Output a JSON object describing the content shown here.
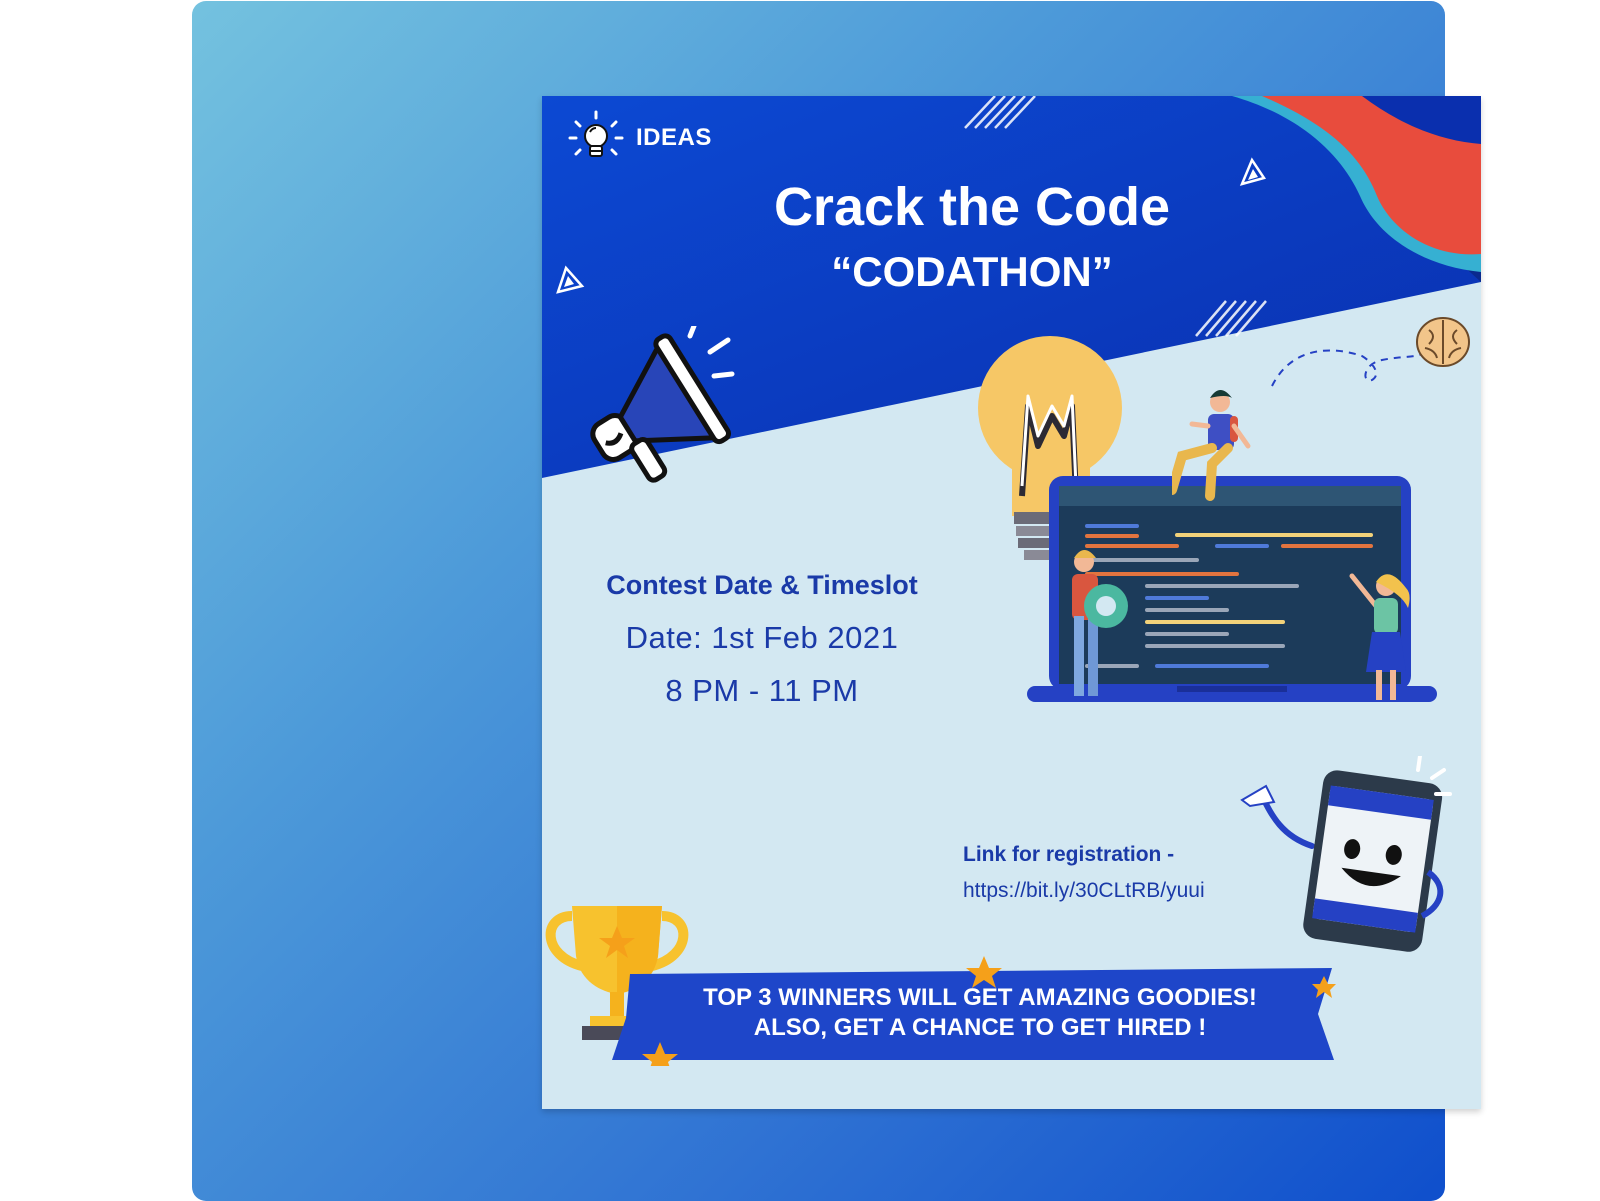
{
  "brand": {
    "name": "IDEAS",
    "icon": "lightbulb-icon"
  },
  "title": "Crack the Code",
  "subtitle": "“CODATHON”",
  "contest": {
    "heading": "Contest Date & Timeslot",
    "date": "Date: 1st Feb 2021",
    "time": "8 PM - 11 PM"
  },
  "registration": {
    "label": "Link for registration -",
    "link": "https://bit.ly/30CLtRB/yuui"
  },
  "banner": {
    "line1": "TOP 3 WINNERS WILL GET AMAZING GOODIES!",
    "line2": "ALSO, GET A CHANCE TO GET HIRED !"
  },
  "colors": {
    "frame_start": "#74c2df",
    "frame_end": "#0f4fcc",
    "poster_bg": "#d3e8f2",
    "primary_blue": "#0b3fc1",
    "accent_red": "#e84c3d",
    "accent_teal": "#36b0d2",
    "trophy_gold": "#f7c22e",
    "star_orange": "#f5a01a"
  },
  "illustrations": [
    "megaphone-icon",
    "lightbulb-illustration",
    "laptop-code-illustration",
    "brain-icon",
    "smartphone-mascot-illustration",
    "trophy-icon",
    "star-icon"
  ]
}
